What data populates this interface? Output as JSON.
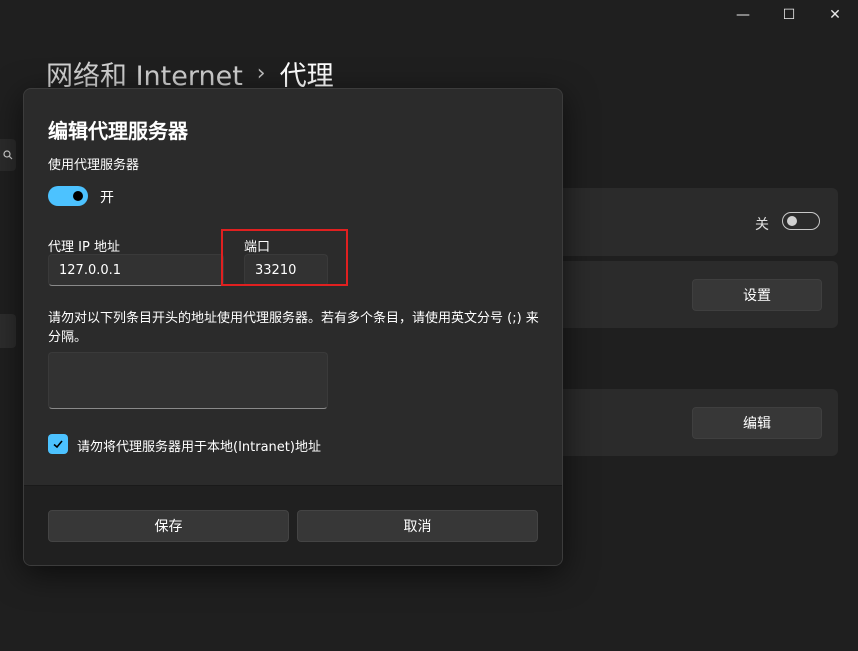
{
  "window": {
    "minimize_glyph": "—",
    "maximize_glyph": "☐",
    "close_glyph": "✕"
  },
  "breadcrumb": {
    "parent": "网络和 Internet",
    "separator": "›",
    "current": "代理"
  },
  "background_cards": {
    "auto_toggle_state": "关",
    "settings_button": "设置",
    "edit_button": "编辑"
  },
  "dialog": {
    "title": "编辑代理服务器",
    "use_proxy_label": "使用代理服务器",
    "toggle_state": "开",
    "toggle_on": true,
    "ip_label": "代理 IP 地址",
    "ip_value": "127.0.0.1",
    "port_label": "端口",
    "port_value": "33210",
    "exceptions_description": "请勿对以下列条目开头的地址使用代理服务器。若有多个条目，请使用英文分号 (;) 来分隔。",
    "exceptions_value": "",
    "bypass_local_label": "请勿将代理服务器用于本地(Intranet)地址",
    "bypass_local_checked": true,
    "save_button": "保存",
    "cancel_button": "取消"
  },
  "colors": {
    "accent": "#4cc2ff",
    "highlight": "#e02020",
    "background": "#1f1f1f",
    "card": "#2b2b2b"
  }
}
